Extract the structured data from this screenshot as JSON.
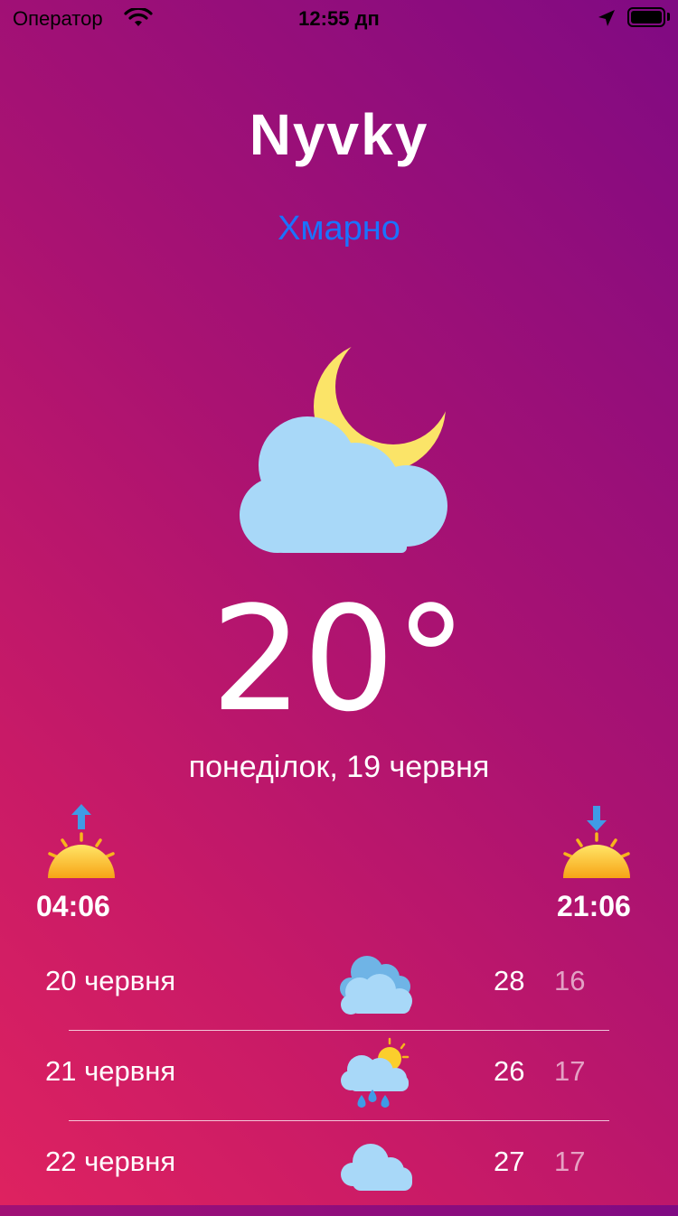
{
  "status_bar": {
    "carrier": "Оператор",
    "time": "12:55 дп",
    "icons": [
      "wifi-icon",
      "location-arrow-icon",
      "battery-icon"
    ]
  },
  "city": "Nyvky",
  "condition": "Хмарно",
  "main_icon": "cloud-moon-icon",
  "temperature": "20°",
  "date": "понеділок, 19 червня",
  "sunrise": {
    "time": "04:06",
    "icon": "sunrise-icon"
  },
  "sunset": {
    "time": "21:06",
    "icon": "sunset-icon"
  },
  "forecast": [
    {
      "date": "20 червня",
      "icon": "cloudy-icon",
      "high": "28",
      "low": "16"
    },
    {
      "date": "21 червня",
      "icon": "rain-sun-icon",
      "high": "26",
      "low": "17"
    },
    {
      "date": "22 червня",
      "icon": "cloud-icon",
      "high": "27",
      "low": "17"
    }
  ],
  "colors": {
    "background_top_right": "#800a83",
    "background_bottom_left": "#de2260",
    "condition_text": "#1a73ff",
    "cloud": "#a8d8f8",
    "moon": "#fbe468"
  }
}
